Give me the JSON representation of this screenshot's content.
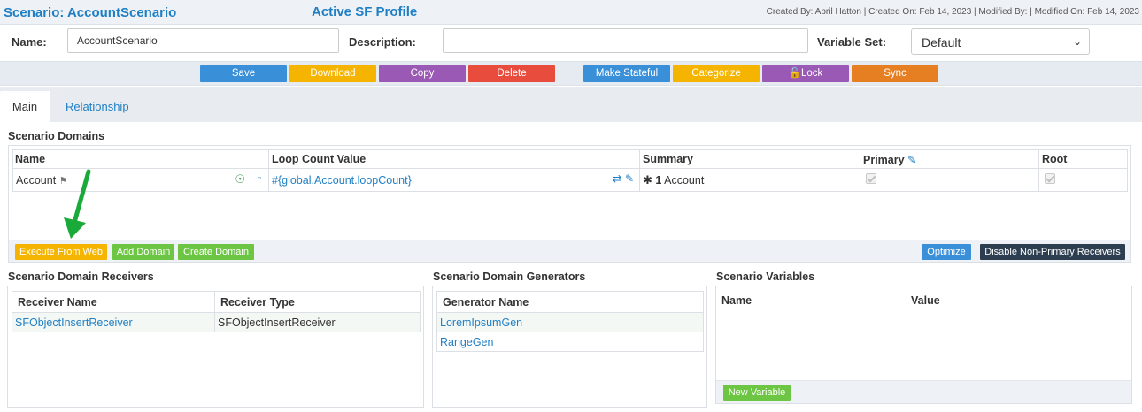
{
  "header": {
    "scenario_title": "Scenario: AccountScenario",
    "profile": "Active SF Profile",
    "meta": "Created By: April Hatton | Created On: Feb 14, 2023 | Modified By: | Modified On: Feb 14, 2023"
  },
  "form": {
    "name_label": "Name:",
    "name_value": "AccountScenario",
    "description_label": "Description:",
    "description_value": "",
    "variable_set_label": "Variable Set:",
    "variable_set_value": "Default"
  },
  "toolbar": {
    "save": "Save",
    "download": "Download",
    "copy": "Copy",
    "delete": "Delete",
    "make_stateful": "Make Stateful",
    "categorize": "Categorize",
    "lock": "Lock",
    "sync": "Sync"
  },
  "tabs": {
    "main": "Main",
    "relationship": "Relationship"
  },
  "domains": {
    "title": "Scenario Domains",
    "headers": {
      "name": "Name",
      "loop": "Loop Count Value",
      "summary": "Summary",
      "primary": "Primary",
      "root": "Root"
    },
    "row": {
      "name": "Account",
      "loop": "#{global.Account.loopCount}",
      "summary_count": "1",
      "summary_label": "Account"
    },
    "buttons": {
      "execute": "Execute From Web",
      "add": "Add Domain",
      "create": "Create Domain",
      "optimize": "Optimize",
      "disable": "Disable Non-Primary Receivers"
    }
  },
  "receivers": {
    "title": "Scenario Domain Receivers",
    "headers": {
      "name": "Receiver Name",
      "type": "Receiver Type"
    },
    "rows": [
      {
        "name": "SFObjectInsertReceiver",
        "type": "SFObjectInsertReceiver"
      }
    ]
  },
  "generators": {
    "title": "Scenario Domain Generators",
    "header": "Generator Name",
    "rows": [
      "LoremIpsumGen",
      "RangeGen"
    ]
  },
  "variables": {
    "title": "Scenario Variables",
    "headers": {
      "name": "Name",
      "value": "Value"
    },
    "new_button": "New Variable"
  },
  "colors": {
    "blue": "#3a8fd9",
    "orange": "#f5b400",
    "purple": "#9b59b6",
    "red": "#e74c3c",
    "dark_orange": "#e67e22",
    "green": "#6cc644",
    "navy": "#2c3e50",
    "arrow": "#1aaa3a"
  }
}
